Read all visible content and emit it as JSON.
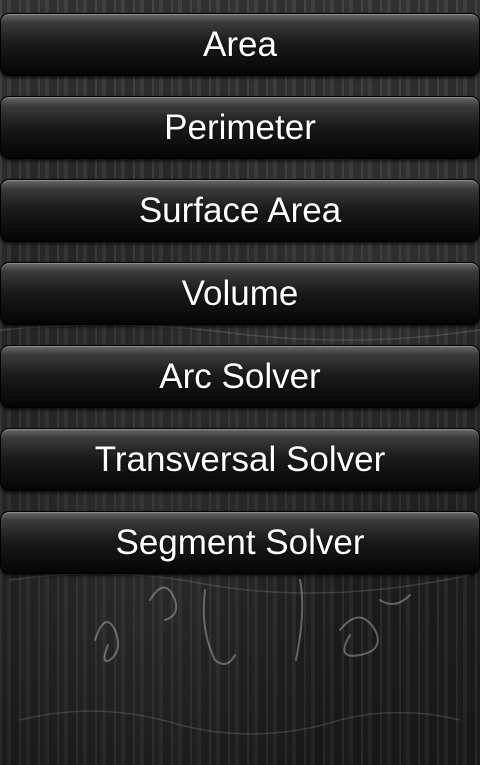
{
  "menu": {
    "items": [
      {
        "label": "Area"
      },
      {
        "label": "Perimeter"
      },
      {
        "label": "Surface Area"
      },
      {
        "label": "Volume"
      },
      {
        "label": "Arc Solver"
      },
      {
        "label": "Transversal Solver"
      },
      {
        "label": "Segment Solver"
      }
    ]
  },
  "colors": {
    "button_top": "#6a6a6a",
    "button_bottom": "#050505",
    "button_text": "#ffffff",
    "background": "#2a2a2a"
  }
}
